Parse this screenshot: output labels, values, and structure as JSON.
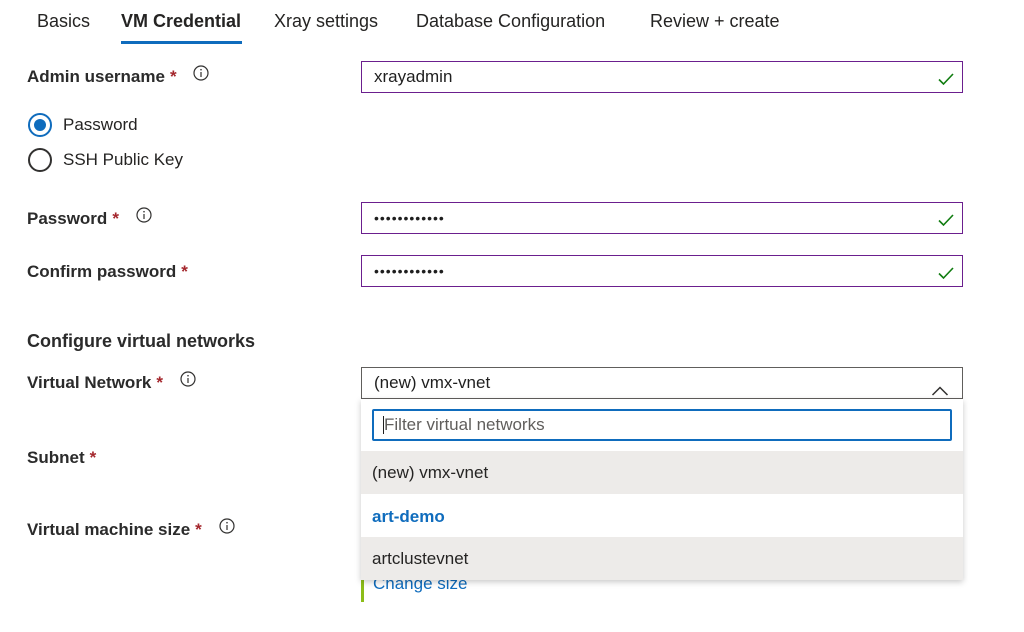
{
  "tabs": [
    {
      "label": "Basics",
      "active": false
    },
    {
      "label": "VM Credential",
      "active": true
    },
    {
      "label": "Xray settings",
      "active": false
    },
    {
      "label": "Database Configuration",
      "active": false
    },
    {
      "label": "Review + create",
      "active": false
    }
  ],
  "form": {
    "required_marker": "*",
    "admin_username": {
      "label": "Admin username",
      "value": "xrayadmin"
    },
    "auth_options": {
      "password": {
        "label": "Password",
        "selected": true
      },
      "ssh": {
        "label": "SSH Public Key",
        "selected": false
      }
    },
    "password": {
      "label": "Password",
      "value": "••••••••••••"
    },
    "confirm_password": {
      "label": "Confirm password",
      "value": "••••••••••••"
    },
    "network_section_title": "Configure virtual networks",
    "virtual_network": {
      "label": "Virtual Network",
      "value": "(new) vmx-vnet",
      "filter_placeholder": "Filter virtual networks",
      "options": [
        "(new) vmx-vnet",
        "art-demo",
        "artclustevnet"
      ]
    },
    "subnet": {
      "label": "Subnet"
    },
    "vm_size": {
      "label": "Virtual machine size",
      "change_size_link": "Change size"
    }
  },
  "colors": {
    "accent": "#0f6cbd",
    "valid_border": "#6b1f8e",
    "valid_check": "#107c10",
    "required": "#a4262c",
    "highlight_row": "#edebe9"
  },
  "icons": {
    "info": "info-icon",
    "valid": "checkmark-icon",
    "dropdown_open": "chevron-up-icon"
  }
}
